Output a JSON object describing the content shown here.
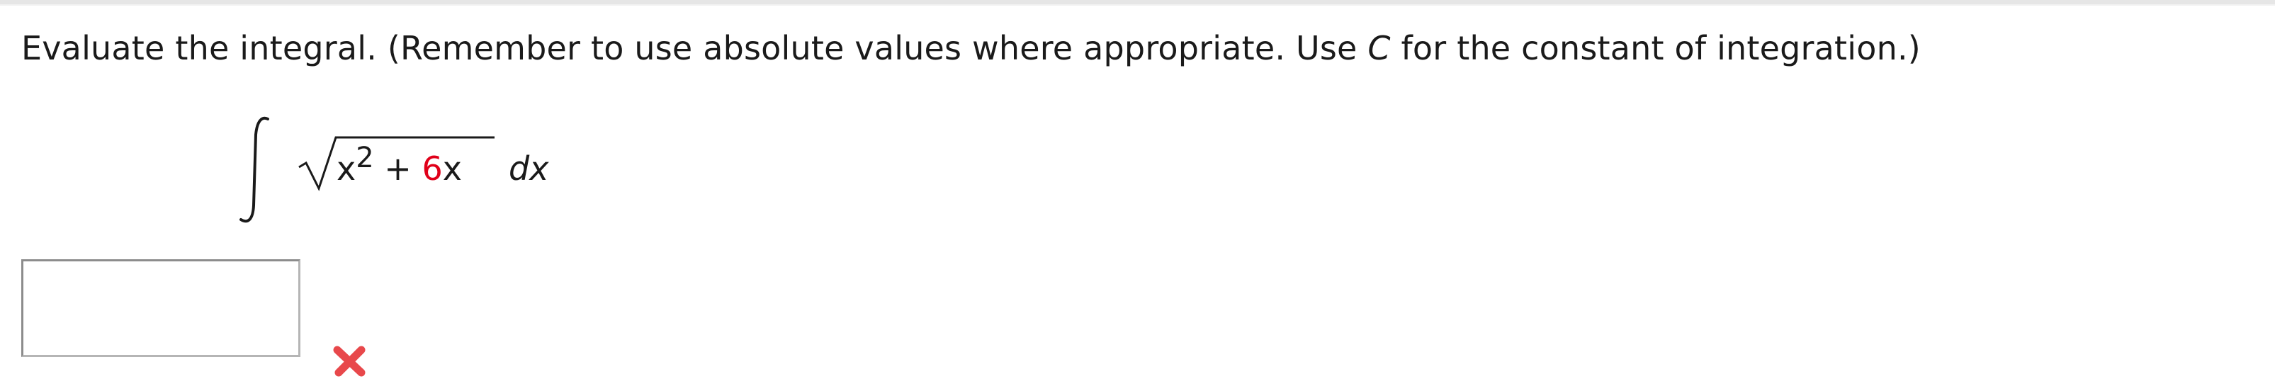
{
  "question": {
    "prompt_before_c": "Evaluate the integral. (Remember to use absolute values where appropriate. Use ",
    "c_symbol": "C",
    "prompt_after_c": " for the constant of integration.)"
  },
  "integral": {
    "integrand_variable": "x",
    "exponent": "2",
    "operator": " + ",
    "coefficient": "6",
    "linear_variable": "x",
    "differential": "dx",
    "highlight_color": "#e0001a"
  },
  "answer": {
    "value": "",
    "status": "incorrect",
    "status_icon": "x-mark-icon",
    "status_color": "#e8484b"
  }
}
